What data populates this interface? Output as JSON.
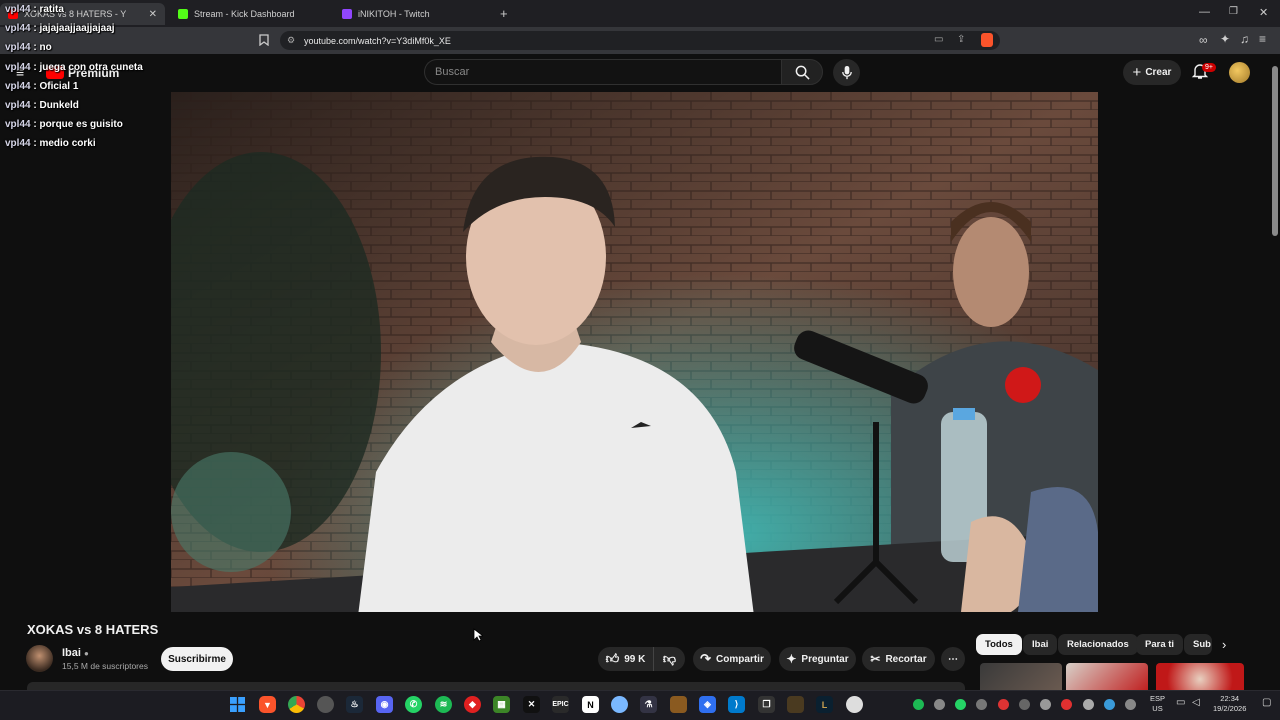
{
  "browser": {
    "tabs": [
      {
        "label": "XOKAS vs 8 HATERS - Y"
      },
      {
        "label": "Stream - Kick Dashboard"
      },
      {
        "label": "iNIKITOH - Twitch"
      }
    ],
    "new_tab": "+",
    "url": "youtube.com/watch?v=Y3diMf0k_XE"
  },
  "youtube": {
    "logo_text": "Premium",
    "search_placeholder": "Buscar",
    "create_label": "Crear",
    "notifications_badge": "9+"
  },
  "chat": [
    {
      "user": "vpl44",
      "msg": "ratita"
    },
    {
      "user": "vpl44",
      "msg": "jajajaajjaajjajaaj"
    },
    {
      "user": "vpl44",
      "msg": "no"
    },
    {
      "user": "vpl44",
      "msg": "juega con otra cuneta"
    },
    {
      "user": "vpl44",
      "msg": "Oficial 1"
    },
    {
      "user": "vpl44",
      "msg": "Dunkeld"
    },
    {
      "user": "vpl44",
      "msg": "porque es guisito"
    },
    {
      "user": "vpl44",
      "msg": "medio corki"
    }
  ],
  "video": {
    "title": "XOKAS vs 8 HATERS",
    "channel": "Ibai",
    "subscribers": "15,5 M de suscriptores",
    "subscribe_label": "Suscribirme",
    "likes": "99 K",
    "share_label": "Compartir",
    "ask_label": "Preguntar",
    "clip_label": "Recortar",
    "more_label": "⋯"
  },
  "chips": [
    "Todos",
    "Ibai",
    "Relacionados",
    "Para ti",
    "Sub"
  ],
  "taskbar": {
    "lang_top": "ESP",
    "lang_bottom": "US",
    "time": "22:34",
    "date": "19/2/2026"
  }
}
